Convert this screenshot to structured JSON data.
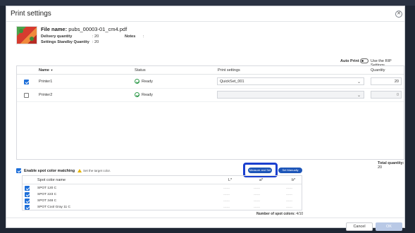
{
  "dialog": {
    "title": "Print settings",
    "close_icon": "close-icon"
  },
  "file": {
    "name_label": "File name:",
    "name_value": "pubs_00003-01_cm4.pdf",
    "delivery_quantity_label": "Delivery quantity",
    "delivery_quantity_value": ": 20",
    "standby_label": "Settings Standby Quantity",
    "standby_value": ": 20",
    "notes_label": "Notes",
    "notes_value": ":"
  },
  "auto_print": {
    "label": "Auto Print",
    "toggle_label": "Use the RIP Settings",
    "enabled": false
  },
  "printers": {
    "columns": {
      "name": "Name",
      "sort_indicator": "▼",
      "status": "Status",
      "print_settings": "Print settings",
      "quantity": "Quantity"
    },
    "rows": [
      {
        "checked": true,
        "name": "Printer1",
        "status": "Ready",
        "print_setting": "QuickSet_001",
        "quantity": "20",
        "enabled": true
      },
      {
        "checked": false,
        "name": "Printer2",
        "status": "Ready",
        "print_setting": "",
        "quantity": "0",
        "enabled": false
      }
    ]
  },
  "total_quantity": {
    "label": "Total quantity:",
    "value": "20"
  },
  "spot_color": {
    "enable_label": "Enable spot color matching",
    "enabled": true,
    "warning_text": "Set the target color.",
    "measure_button": "Measure and Set",
    "manual_button": "Set Manually",
    "columns": {
      "name": "Spot color name",
      "l": "L*",
      "a": "a*",
      "b": "b*"
    },
    "rows": [
      {
        "checked": true,
        "name": "SPOT 120 C",
        "l": "------",
        "a": "------",
        "b": "------"
      },
      {
        "checked": true,
        "name": "SPOT 223 C",
        "l": "------",
        "a": "------",
        "b": "------"
      },
      {
        "checked": true,
        "name": "SPOT 348 C",
        "l": "------",
        "a": "------",
        "b": "------"
      },
      {
        "checked": true,
        "name": "SPOT Cool Gray 11 C",
        "l": "------",
        "a": "------",
        "b": "------"
      }
    ],
    "count_label": "Number of spot colors:",
    "count_value": "4/10"
  },
  "footer": {
    "cancel": "Cancel",
    "ok": "OK"
  },
  "colors": {
    "accent": "#1e56b8",
    "highlight": "#1a3fcf",
    "ready": "#2f9a4a",
    "warning": "#e6b300"
  }
}
